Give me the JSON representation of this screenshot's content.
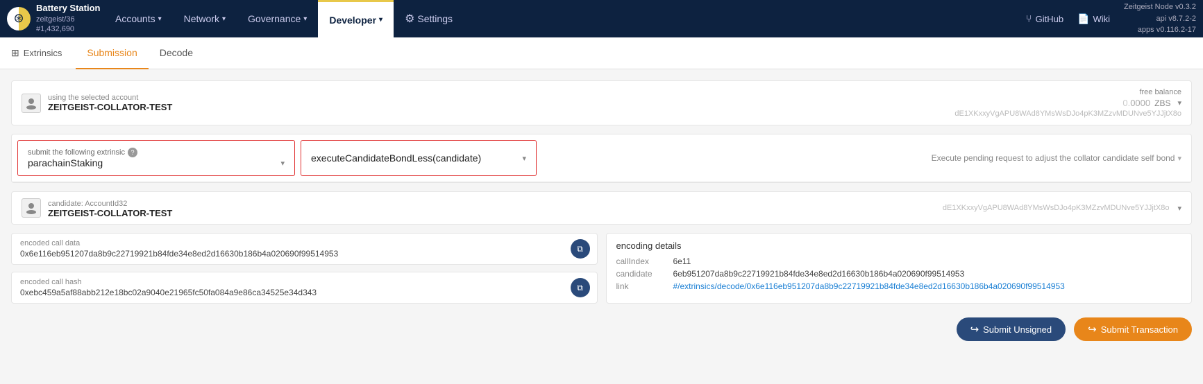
{
  "brand": {
    "name": "Battery Station",
    "sub": "zeitgeist/36\n#1,432,690",
    "logo_alt": "Battery Station Logo"
  },
  "nav": {
    "items": [
      {
        "label": "Accounts",
        "active": false,
        "has_dropdown": true
      },
      {
        "label": "Network",
        "active": false,
        "has_dropdown": true
      },
      {
        "label": "Governance",
        "active": false,
        "has_dropdown": true
      },
      {
        "label": "Developer",
        "active": true,
        "has_dropdown": true
      },
      {
        "label": "Settings",
        "active": false,
        "has_dropdown": false
      }
    ],
    "right_links": [
      {
        "label": "GitHub",
        "icon": "github-icon"
      },
      {
        "label": "Wiki",
        "icon": "wiki-icon"
      }
    ]
  },
  "version": {
    "node": "Zeitgeist Node v0.3.2",
    "api": "api v8.7.2-2",
    "apps": "apps v0.116.2-17"
  },
  "tabs": {
    "section_label": "Extrinsics",
    "items": [
      {
        "label": "Submission",
        "active": true
      },
      {
        "label": "Decode",
        "active": false
      }
    ]
  },
  "account": {
    "label": "using the selected account",
    "name": "ZEITGEIST-COLLATOR-TEST",
    "free_balance_label": "free balance",
    "balance": "0.0000",
    "denom": "ZBS",
    "address": "dE1XKxxyVgAPU8WAd8YMsWsDJo4pK3MZzvMDUNve5YJJjtX8o"
  },
  "extrinsic": {
    "label": "submit the following extrinsic",
    "module": "parachainStaking",
    "method": "executeCandidateBondLess(candidate)",
    "description": "Execute pending request to adjust the collator candidate self bond"
  },
  "candidate": {
    "label": "candidate: AccountId32",
    "name": "ZEITGEIST-COLLATOR-TEST",
    "address": "dE1XKxxyVgAPU8WAd8YMsWsDJo4pK3MZzvMDUNve5YJJjtX8o"
  },
  "encoded_call": {
    "label": "encoded call data",
    "value": "0x6e116eb951207da8b9c22719921b84fde34e8ed2d16630b186b4a020690f99514953"
  },
  "encoded_hash": {
    "label": "encoded call hash",
    "value": "0xebc459a5af88abb212e18bc02a9040e21965fc50fa084a9e86ca34525e34d343"
  },
  "encoding_details": {
    "title": "encoding details",
    "call_index_label": "callIndex",
    "call_index_value": "6e11",
    "candidate_label": "candidate",
    "candidate_value": "6eb951207da8b9c22719921b84fde34e8ed2d16630b186b4a020690f99514953",
    "link_label": "link",
    "link_value": "#/extrinsics/decode/0x6e116eb951207da8b9c22719921b84fde34e8ed2d16630b186b4a020690f99514953",
    "link_text": "#/extrinsics/decode/0x6e116eb951207da8b9c22719921b84fde34e8ed2d16630b186b4a020690f99514953"
  },
  "buttons": {
    "submit_unsigned": "Submit Unsigned",
    "submit_transaction": "Submit Transaction"
  }
}
